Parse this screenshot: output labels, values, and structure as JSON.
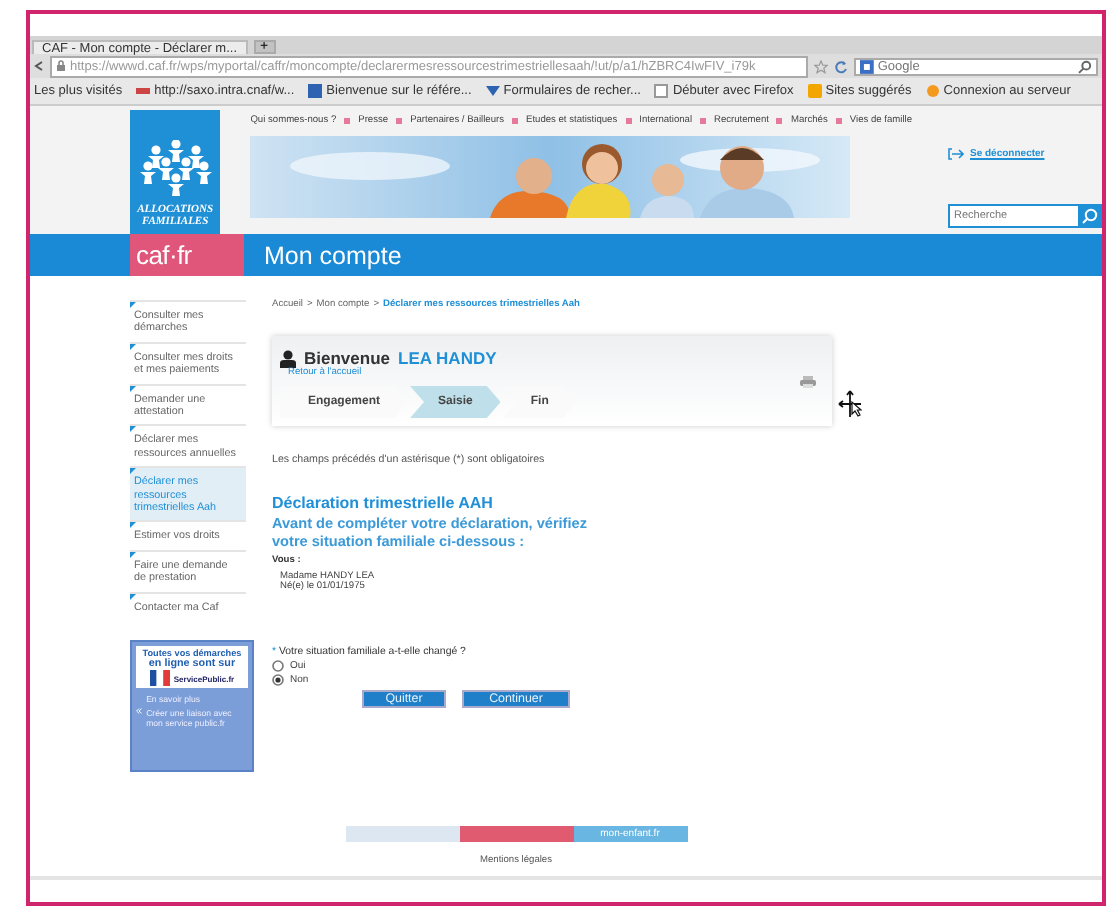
{
  "browser": {
    "tab_title": "CAF - Mon compte - Déclarer m...",
    "new_tab": "+",
    "url": "https://wwwd.caf.fr/wps/myportal/caffr/moncompte/declarermesressourcestrimestriellesaah/!ut/p/a1/hZBRC4IwFIV_i79k",
    "search_placeholder": "Google",
    "bookmarks_label": "Les plus visités",
    "bookmarks": [
      "http://saxo.intra.cnaf/w...",
      "Bienvenue sur le référe...",
      "Formulaires de recher...",
      "Débuter avec Firefox",
      "Sites suggérés",
      "Connexion au serveur"
    ]
  },
  "header": {
    "logo_text": "ALLOCATIONS FAMILIALES",
    "nav": [
      "Qui sommes-nous ?",
      "Presse",
      "Partenaires / Bailleurs",
      "Etudes et statistiques",
      "International",
      "Recrutement",
      "Marchés",
      "Vies de famille"
    ],
    "logout": "Se déconnecter",
    "search_placeholder": "Recherche"
  },
  "title_bar": {
    "brand": "caf·fr",
    "title": "Mon compte"
  },
  "sidebar": {
    "items": [
      {
        "label": "Consulter mes démarches",
        "selected": false
      },
      {
        "label": "Consulter mes droits et mes paiements",
        "selected": false
      },
      {
        "label": "Demander une attestation",
        "selected": false
      },
      {
        "label": "Déclarer mes ressources annuelles",
        "selected": false
      },
      {
        "label": "Déclarer mes ressources trimestrielles Aah",
        "selected": true
      },
      {
        "label": "Estimer vos droits",
        "selected": false
      },
      {
        "label": "Faire une demande de prestation",
        "selected": false
      },
      {
        "label": "Contacter ma Caf",
        "selected": false
      }
    ],
    "promo": {
      "title_lines": [
        "Toutes vos démarches",
        "en ligne sont sur"
      ],
      "logo_text": "ServicePublic.fr",
      "links": [
        "En savoir plus",
        "Créer une liaison avec mon service public.fr"
      ]
    }
  },
  "breadcrumb": {
    "separator": ">",
    "items": [
      "Accueil",
      "Mon compte",
      "Déclarer mes ressources trimestrielles Aah"
    ]
  },
  "welcome": {
    "greeting": "Bienvenue",
    "name": "LEA HANDY",
    "back_link": "Retour à l'accueil"
  },
  "steps": [
    {
      "label": "Engagement",
      "selected": false
    },
    {
      "label": "Saisie",
      "selected": true
    },
    {
      "label": "Fin",
      "selected": false
    }
  ],
  "required_note": "Les champs précédés d'un astérisque (*) sont obligatoires",
  "form": {
    "heading": "Déclaration trimestrielle AAH",
    "subheading": "Avant de compléter votre déclaration, vérifiez votre situation familiale ci-dessous :",
    "you_label": "Vous :",
    "person_lines": [
      "Madame HANDY LEA",
      "Né(e) le 01/01/1975"
    ],
    "question": {
      "required_mark": "*",
      "label": "Votre situation familiale a-t-elle changé ?",
      "options": [
        {
          "label": "Oui",
          "selected": false
        },
        {
          "label": "Non",
          "selected": true
        }
      ]
    },
    "buttons": [
      "Quitter",
      "Continuer"
    ]
  },
  "footer": {
    "partners": [
      {
        "color": "#dce7f1"
      },
      {
        "color": "#e05a70"
      },
      {
        "color": "#6ab6e2",
        "label": "mon-enfant.fr"
      }
    ],
    "legal_link": "Mentions légales"
  }
}
